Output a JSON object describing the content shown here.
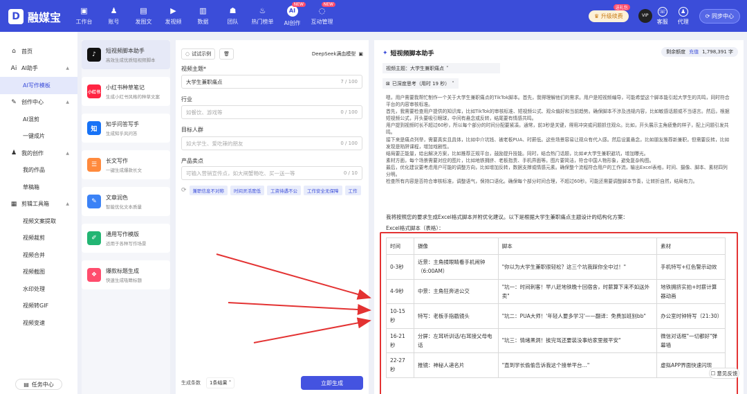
{
  "brand": {
    "name": "融媒宝",
    "mark": "D"
  },
  "nav": [
    {
      "label": "工作台",
      "icon": "▣"
    },
    {
      "label": "账号",
      "icon": "♟"
    },
    {
      "label": "发图文",
      "icon": "▤"
    },
    {
      "label": "发视频",
      "icon": "▶"
    },
    {
      "label": "数据",
      "icon": "▥"
    },
    {
      "label": "团队",
      "icon": "☗"
    },
    {
      "label": "热门榜单",
      "icon": "♨"
    },
    {
      "label": "AI创作",
      "icon": "AI",
      "badge": "NEW"
    },
    {
      "label": "互动管理",
      "icon": "◌",
      "badge": "NEW"
    }
  ],
  "top_right": {
    "upgrade": "升级续费",
    "upgrade_badge": "送礼包",
    "service": "客服",
    "agent": "代理",
    "sync": "同步中心",
    "avatar_text": "VIP"
  },
  "sidebar": [
    {
      "label": "首页",
      "icon": "⌂",
      "type": "top"
    },
    {
      "label": "AI助手",
      "icon": "Ai",
      "type": "top",
      "expandable": true
    },
    {
      "label": "AI写作模板",
      "type": "sub",
      "active": true
    },
    {
      "label": "创作中心",
      "icon": "✎",
      "type": "top",
      "expandable": true
    },
    {
      "label": "AI混剪",
      "type": "sub"
    },
    {
      "label": "一键成片",
      "type": "sub"
    },
    {
      "label": "我的创作",
      "icon": "♟",
      "type": "top",
      "expandable": true
    },
    {
      "label": "我的作品",
      "type": "sub"
    },
    {
      "label": "草稿箱",
      "type": "sub"
    },
    {
      "label": "剪辑工具箱",
      "icon": "▦",
      "type": "top",
      "expandable": true
    },
    {
      "label": "视频文案提取",
      "type": "sub"
    },
    {
      "label": "视频裁剪",
      "type": "sub"
    },
    {
      "label": "视频合并",
      "type": "sub"
    },
    {
      "label": "视频截图",
      "type": "sub"
    },
    {
      "label": "水印处理",
      "type": "sub"
    },
    {
      "label": "视频转GIF",
      "type": "sub"
    },
    {
      "label": "视频变速",
      "type": "sub"
    }
  ],
  "task_center": "任务中心",
  "tools": [
    {
      "title": "短视频脚本助手",
      "desc": "高效生成优质短视频脚本",
      "icon": "♪",
      "color": "#111111",
      "active": true
    },
    {
      "title": "小红书种草笔记",
      "desc": "生成小红书风格的种草文案",
      "icon": "小红书",
      "color": "#ff2442",
      "active": true
    },
    {
      "title": "知乎问答写手",
      "desc": "生成知乎风问答",
      "icon": "知",
      "color": "#1772f6"
    },
    {
      "title": "长文写作",
      "desc": "一键生成爆款长文",
      "icon": "☰",
      "color": "#ff8a3d"
    },
    {
      "title": "文章润色",
      "desc": "智能优化文本质量",
      "icon": "✎",
      "color": "#3b82f6"
    },
    {
      "title": "通用写作模版",
      "desc": "适用于各种写作场景",
      "icon": "✐",
      "color": "#22b573"
    },
    {
      "title": "爆款标题生成",
      "desc": "快速生成吸睛标题",
      "icon": "❖",
      "color": "#ff4d6d"
    }
  ],
  "form": {
    "example_btn": "试试示例",
    "model": "DeepSeek满血模型",
    "topic_label": "视频主题*",
    "topic_value": "大学生兼职痛点",
    "topic_count": "7 / 100",
    "industry_label": "行业",
    "industry_placeholder": "如餐饮、游戏等",
    "industry_count": "0 / 100",
    "audience_label": "目标人群",
    "audience_placeholder": "如大学生、爱吃辣的朋友",
    "audience_count": "0 / 100",
    "selling_label": "产品卖点",
    "selling_placeholder": "可输入营销宣传点，如大闸蟹畅吃、买一送一等",
    "selling_count": "0 / 10",
    "chips": [
      "兼职信息不对称",
      "时间灵活度低",
      "工资待遇不公",
      "工作安全无保障",
      "工作"
    ],
    "count_label": "生成条数",
    "count_value": "1条结果",
    "generate_btn": "立即生成"
  },
  "result": {
    "title": "短视频脚本助手",
    "balance_label": "剩余额度",
    "recharge": "充值",
    "balance_value": "1,798,391 字",
    "topic_tag": "视频主题：大学生兼职痛点",
    "think_tag": "已深度思考（用时 19 秒）",
    "thinking": [
      "嗯，用户需要我帮忙制作一个关于大学生兼职痛点的TikTok脚本。首先，我得理解他们的需求。用户是短视频编导，可能希望这个脚本能引起大学生的共鸣，同时符合平台的内容审核标准。",
      "首先，我需要检查用户提供的知识库，比如TikTok的审核标准、短视频公式、观众偏好和当前趋势。确保脚本不涉及违规内容，比如敏感话题或不当语言。然后，根据短视频公式，开头要吸引眼球，中间有悬念或反转，结尾要有情感共鸣。",
      "用户提到视频时长不超过60秒，所以每个部分的时间分配要紧凑。通常，前3秒是关键，得用冲突或问题抓住观众。比如，开头展示主角疲惫的样子，配上问题引发共鸣。",
      "接下来是痛点列举，需要真实且具体，比如中介坑钱、被老板PUA、时薪低。这些场景容易让观众有代入感。然后设置悬念，比如朋友推荐新兼职，但需要反转，比如发现是陷阱课程，增加戏剧性。",
      "结局要正能量，给出解决方案，比如推荐正规平台，鼓励提升技能。同时，结合热门话题，比如#大学生兼职避坑，增加曝光。",
      "素材方面，每个场景需要对应的图片，比如地铁拥挤、老板指责、手机界面等。图片要简洁，符合中国人物形象，避免复杂构图。",
      "最后，优化建议要考虑用户可能的调整方向，比如增加反转，数据支撑或情感元素。确保整个流程符合用户的工作流，输出Excel表格，时间、摄像、脚本、素材四列分明。",
      "检查所有内容是否符合审核标准，调整语气，保持口语化。确保每个部分时间合理，不超过60秒。可能还需要调整脚本节奏，让转折自然，结局有力。"
    ],
    "intro": "我将按照您的要求生成Excel格式脚本并附优化建议。以下是根据大学生兼职痛点主题设计的结构化方案：",
    "table_title": "Excel格式脚本（表格）：",
    "columns": [
      "时间",
      "摄像",
      "脚本",
      "素材"
    ],
    "rows": [
      [
        "0-3秒",
        "近景：主角揉眼睛看手机闹钟（6:00AM）",
        "\"你以为大学生兼职很轻松？这三个坑我踩你全中过！\"",
        "手机特写+红色警示动效"
      ],
      [
        "4-9秒",
        "中景：主角狂奔进公交",
        "\"坑一：时间刺客！早八赶地铁晚十回宿舍，时薪算下来不如送外卖\"",
        "地铁拥挤实拍+时薪计算器动画"
      ],
      [
        "10-15秒",
        "特写：老板手指戳镜头",
        "\"坑二：PUA大师！'年轻人要多学习'——翻译：免费加班别bb\"",
        "办公室时钟特写（21:30）"
      ],
      [
        "16-21秒",
        "分屏：左耳听训话/右耳接父母电话",
        "\"坑三：情绪黑洞！挨完骂还要装没事给家里报平安\"",
        "微信对话框\"一切都好\"弹幕墙"
      ],
      [
        "22-27秒",
        "推镜：神秘人递名片",
        "\"直到学长偷偷告诉我这个接单平台...\"",
        "虚拟APP界面快速闪现"
      ]
    ]
  },
  "help": "意见反馈"
}
